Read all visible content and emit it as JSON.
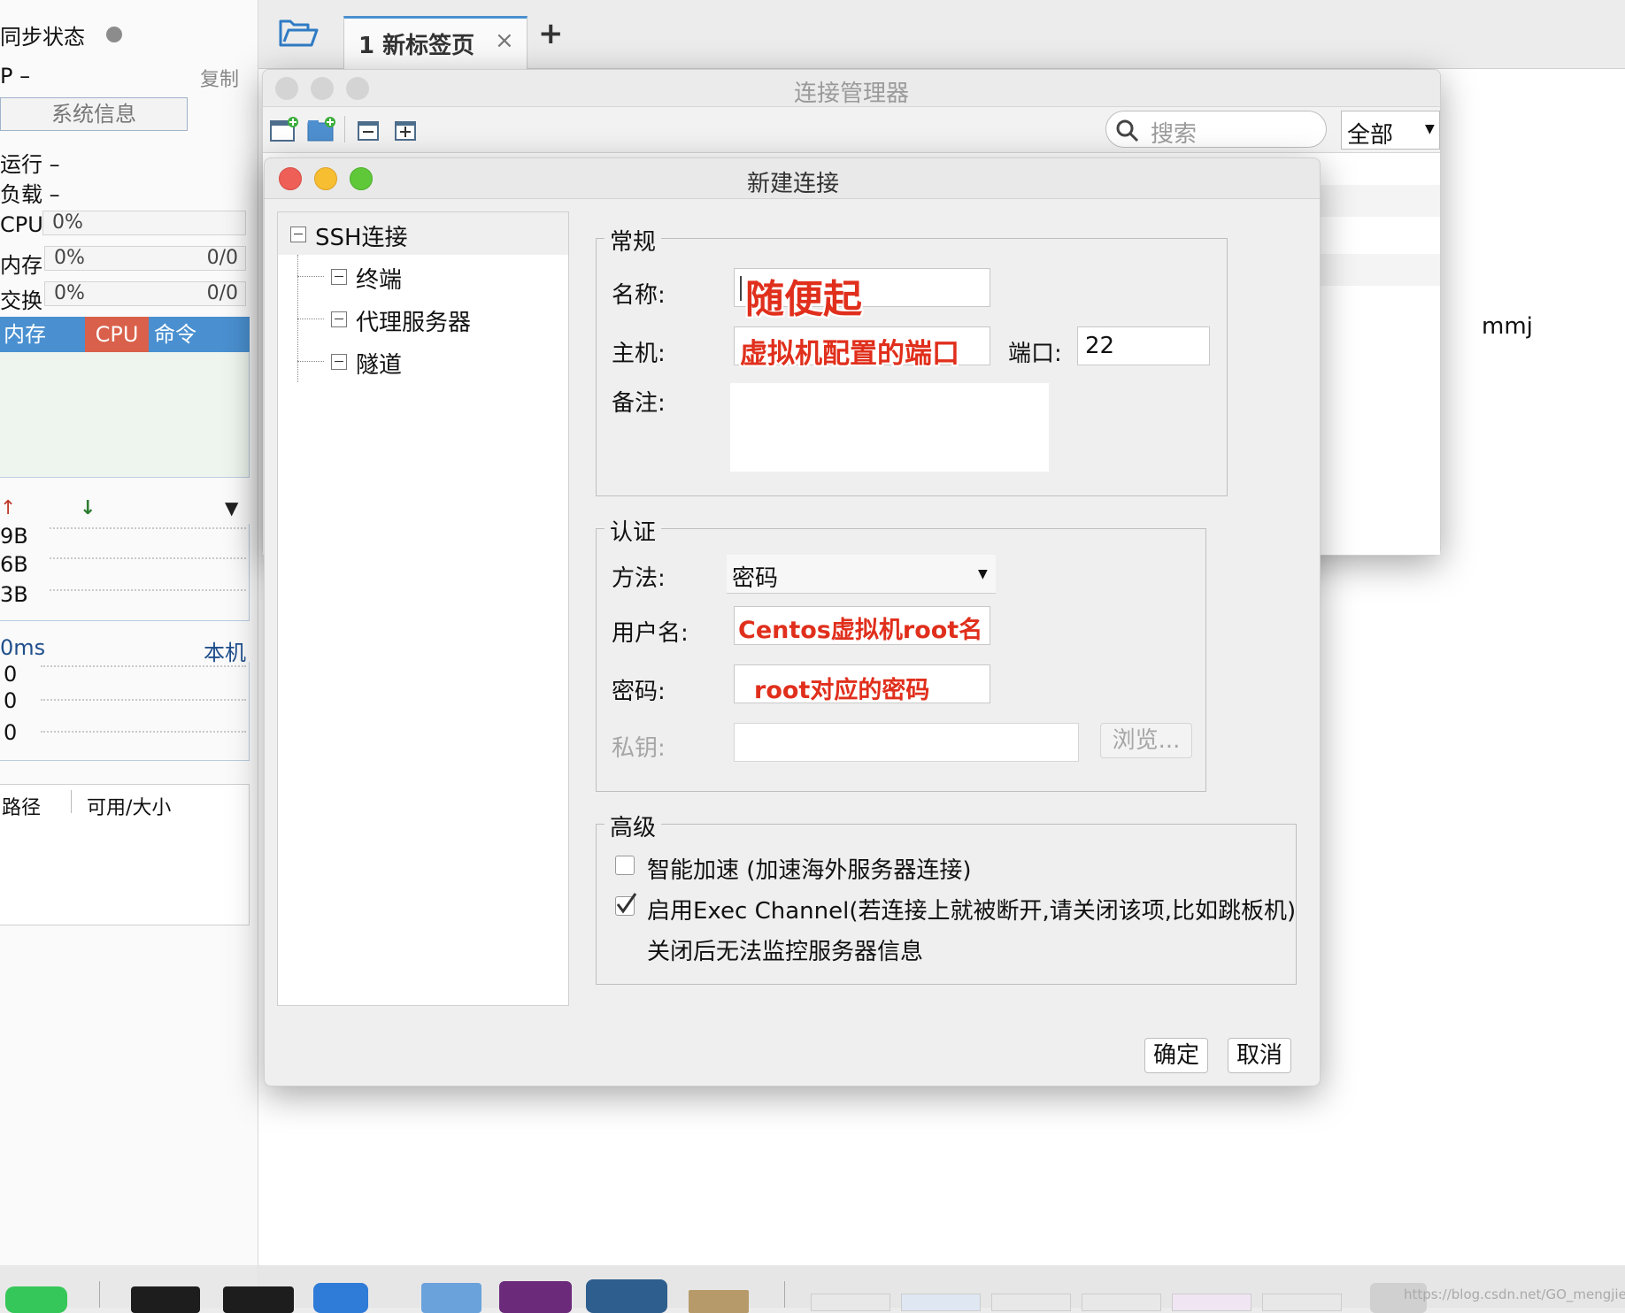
{
  "sidebar": {
    "sync_status": "同步状态",
    "ip_label": "P –",
    "copy": "复制",
    "sysinfo_button": "系统信息",
    "run": "运行 –",
    "load": "负载 –",
    "cpu_label": "CPU",
    "cpu_value": "0%",
    "mem_label": "内存",
    "mem_value": "0%",
    "mem_ratio": "0/0",
    "swap_label": "交换",
    "swap_value": "0%",
    "swap_ratio": "0/0",
    "proc_tabs": [
      "内存",
      "CPU",
      "命令"
    ],
    "net_rows": [
      "9B",
      "6B",
      "3B"
    ],
    "latency_label": "0ms",
    "latency_target": "本机",
    "latency_rows": [
      "0",
      "0",
      "0"
    ],
    "disk_headers": [
      "路径",
      "可用/大小"
    ]
  },
  "tabs": {
    "active_label": "1 新标签页",
    "close": "×",
    "add": "+"
  },
  "background": {
    "user_text": "mmj"
  },
  "conn_manager": {
    "title": "连接管理器",
    "search_placeholder": "搜索",
    "filter_value": "全部"
  },
  "dialog": {
    "title": "新建连接",
    "tree": {
      "root": "SSH连接",
      "children": [
        "终端",
        "代理服务器",
        "隧道"
      ]
    },
    "general": {
      "legend": "常规",
      "name_label": "名称:",
      "name_annotation": "随便起",
      "host_label": "主机:",
      "host_annotation": "虚拟机配置的端口",
      "port_label": "端口:",
      "port_value": "22",
      "note_label": "备注:"
    },
    "auth": {
      "legend": "认证",
      "method_label": "方法:",
      "method_value": "密码",
      "user_label": "用户名:",
      "user_annotation": "Centos虚拟机root名",
      "password_label": "密码:",
      "password_annotation": "root对应的密码",
      "key_label": "私钥:",
      "browse": "浏览..."
    },
    "advanced": {
      "legend": "高级",
      "smart_accel": "智能加速 (加速海外服务器连接)",
      "exec_channel": "启用Exec Channel(若连接上就被断开,请关闭该项,比如跳板机)",
      "exec_note": "关闭后无法监控服务器信息"
    },
    "ok": "确定",
    "cancel": "取消"
  },
  "watermark": "https://blog.csdn.net/GO_mengjie"
}
